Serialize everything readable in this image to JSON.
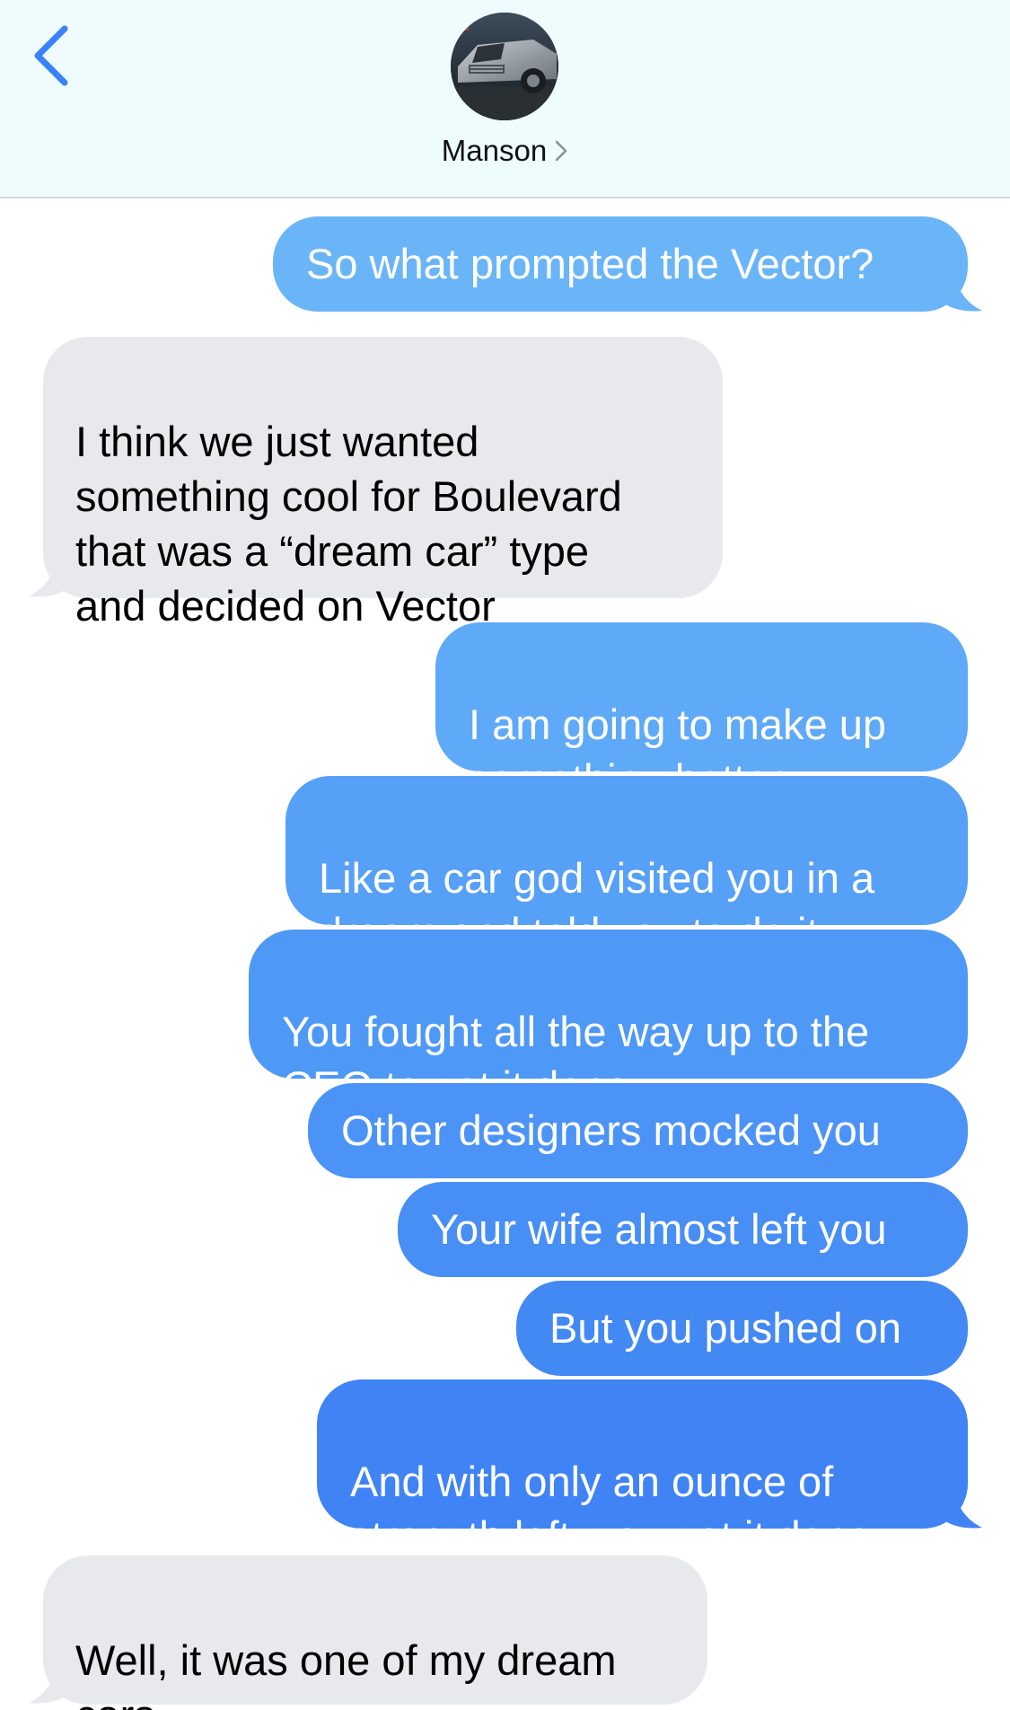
{
  "header": {
    "back_icon": "chevron-left-icon",
    "contact_name": "Manson",
    "contact_chevron_icon": "chevron-right-icon",
    "accent_color": "#3a82f7"
  },
  "messages": [
    {
      "direction": "sent",
      "text": "So what prompted the Vector?",
      "color": "#6ab5f8"
    },
    {
      "direction": "received",
      "text": "I think we just wanted\nsomething cool for Boulevard\nthat was a “dream car” type\nand decided on Vector",
      "color": "#e8e9ec"
    },
    {
      "direction": "sent",
      "text": "I am going to make up\nsomething better",
      "color": "#5ea9f8"
    },
    {
      "direction": "sent",
      "text": "Like a car god visited you in a\ndream and told you to do it",
      "color": "#56a0f7"
    },
    {
      "direction": "sent",
      "text": "You fought all the way up to the\nCEO to get it done",
      "color": "#4e98f6"
    },
    {
      "direction": "sent",
      "text": "Other designers mocked you",
      "color": "#4b93f6"
    },
    {
      "direction": "sent",
      "text": "Your wife almost left you",
      "color": "#478ef5"
    },
    {
      "direction": "sent",
      "text": "But you pushed on",
      "color": "#4389f4"
    },
    {
      "direction": "sent",
      "text": "And with only an ounce of\nstrength left, you got it done",
      "color": "#3f83f4"
    },
    {
      "direction": "received",
      "text": "Well, it was one of my dream\ncars.",
      "color": "#e8e9ec"
    }
  ]
}
